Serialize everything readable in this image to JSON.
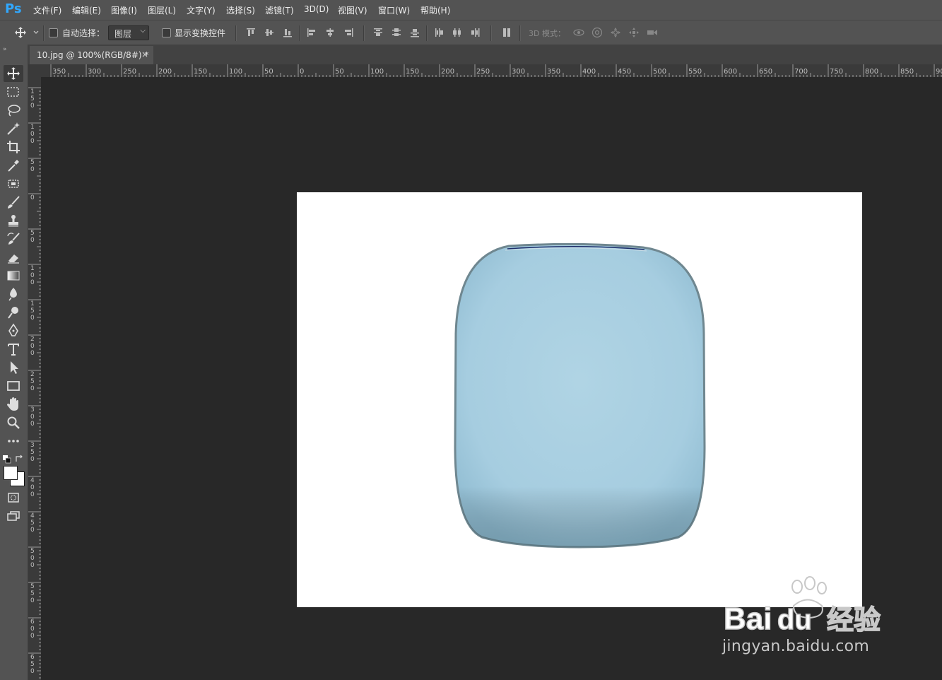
{
  "app": {
    "logo": "Ps"
  },
  "menu": [
    "文件(F)",
    "编辑(E)",
    "图像(I)",
    "图层(L)",
    "文字(Y)",
    "选择(S)",
    "滤镜(T)",
    "3D(D)",
    "视图(V)",
    "窗口(W)",
    "帮助(H)"
  ],
  "options": {
    "auto_select_label": "自动选择：",
    "layer_select_value": "图层",
    "show_transform_label": "显示变换控件",
    "mode_3d_label": "3D 模式："
  },
  "tab": {
    "title": "10.jpg @ 100%(RGB/8#) *",
    "close": "×"
  },
  "ruler": {
    "h_labels": [
      "350",
      "300",
      "250",
      "200",
      "150",
      "100",
      "50",
      "0",
      "50",
      "100",
      "150",
      "200",
      "250",
      "300",
      "350",
      "400",
      "450",
      "500",
      "550",
      "600",
      "650",
      "700",
      "750",
      "800",
      "850",
      "90"
    ],
    "v_labels": [
      "150",
      "100",
      "50",
      "0",
      "50",
      "100",
      "150",
      "200",
      "250",
      "300",
      "350",
      "400",
      "450",
      "500",
      "550",
      "600",
      "650"
    ]
  },
  "watermark": {
    "brand": "Bai du 经验",
    "url": "jingyan.baidu.com"
  },
  "tools": [
    "move-tool-icon",
    "rectangular-marquee-icon",
    "lasso-icon",
    "magic-wand-icon",
    "crop-icon",
    "eyedropper-icon",
    "spot-healing-icon",
    "brush-icon",
    "clone-stamp-icon",
    "history-brush-icon",
    "eraser-icon",
    "gradient-icon",
    "blur-icon",
    "dodge-icon",
    "pen-icon",
    "type-icon",
    "path-selection-icon",
    "rectangle-icon",
    "hand-icon",
    "zoom-icon",
    "more-tools-icon"
  ],
  "colors": {
    "foreground": "#ffffff",
    "background": "#ffffff",
    "object": "#a9cfe0",
    "accent": "#31a8ff"
  }
}
